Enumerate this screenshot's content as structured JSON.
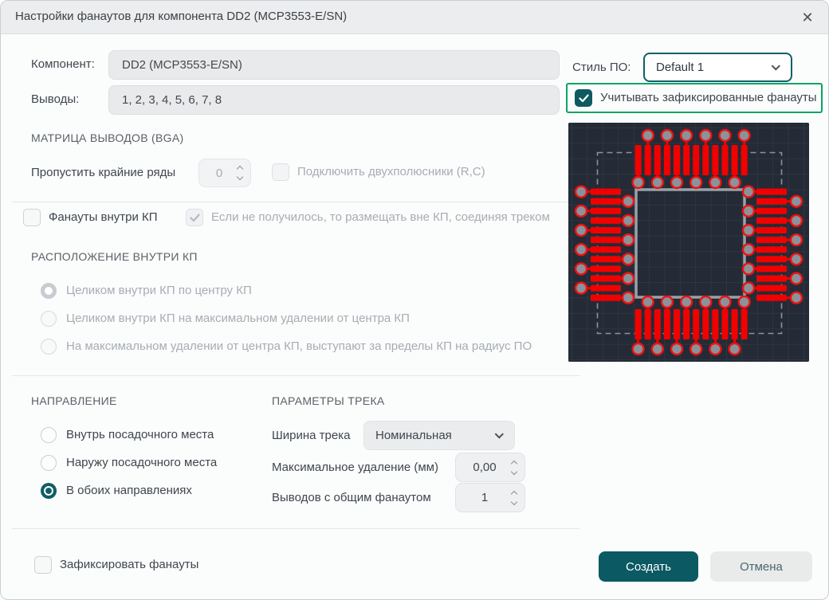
{
  "theme": {
    "accent_teal": "#0d5c63",
    "highlight_green": "#0ba365",
    "primary_button_bg": "#0b5963",
    "trace_red": "#f20000"
  },
  "titlebar": {
    "title": "Настройки фанаутов для компонента DD2 (MCP3553-E/SN)"
  },
  "icons": {
    "close": "✕"
  },
  "form": {
    "component_label": "Компонент:",
    "component_value": "DD2 (MCP3553-E/SN)",
    "pins_label": "Выводы:",
    "pins_value": "1, 2, 3, 4, 5, 6, 7, 8",
    "style_label": "Стиль ПО:",
    "style_value": "Default 1",
    "respect_fixed_label": "Учитывать зафиксированные фанауты",
    "respect_fixed_checked": true,
    "bga_header": "МАТРИЦА ВЫВОДОВ (BGA)",
    "skip_rows_label": "Пропустить крайние ряды",
    "skip_rows_value": "0",
    "two_pole_label": "Подключить двухполюсники (R,C)",
    "two_pole_checked": false,
    "inside_pad_label": "Фанауты внутри КП",
    "inside_pad_checked": false,
    "fallback_label": "Если не получилось, то размещать вне КП, соединяя треком",
    "fallback_checked": true,
    "placement_header": "РАСПОЛОЖЕНИЕ ВНУТРИ КП",
    "placement_options": [
      {
        "label": "Целиком внутри КП по центру КП",
        "selected": true
      },
      {
        "label": "Целиком внутри КП на максимальном удалении от центра КП",
        "selected": false
      },
      {
        "label": "На максимальном удалении от центра КП, выступают за пределы КП на радиус ПО",
        "selected": false
      }
    ],
    "direction_header": "НАПРАВЛЕНИЕ",
    "direction_options": [
      {
        "label": "Внутрь посадочного места",
        "selected": false
      },
      {
        "label": "Наружу посадочного места",
        "selected": false
      },
      {
        "label": "В обоих направлениях",
        "selected": true
      }
    ],
    "track_header": "ПАРАМЕТРЫ ТРЕКА",
    "track_width_label": "Ширина трека",
    "track_width_value": "Номинальная",
    "max_distance_label": "Максимальное удаление (мм)",
    "max_distance_value": "0,00",
    "common_fanout_label": "Выводов с общим фанаутом",
    "common_fanout_value": "1",
    "fix_label": "Зафиксировать фанауты",
    "fix_checked": false
  },
  "footer": {
    "create_label": "Создать",
    "cancel_label": "Отмена"
  },
  "preview": {
    "description": "QFP footprint with red fanout traces routed in both directions to vias",
    "pads_per_side": 12,
    "colors": {
      "bg": "#242b36",
      "grid": "#2d3642",
      "courtyard": "#8d939b",
      "body": "#99a1a9",
      "trace": "#f20000",
      "via_fill": "#8b9299",
      "via_ring": "#ee1111"
    }
  }
}
